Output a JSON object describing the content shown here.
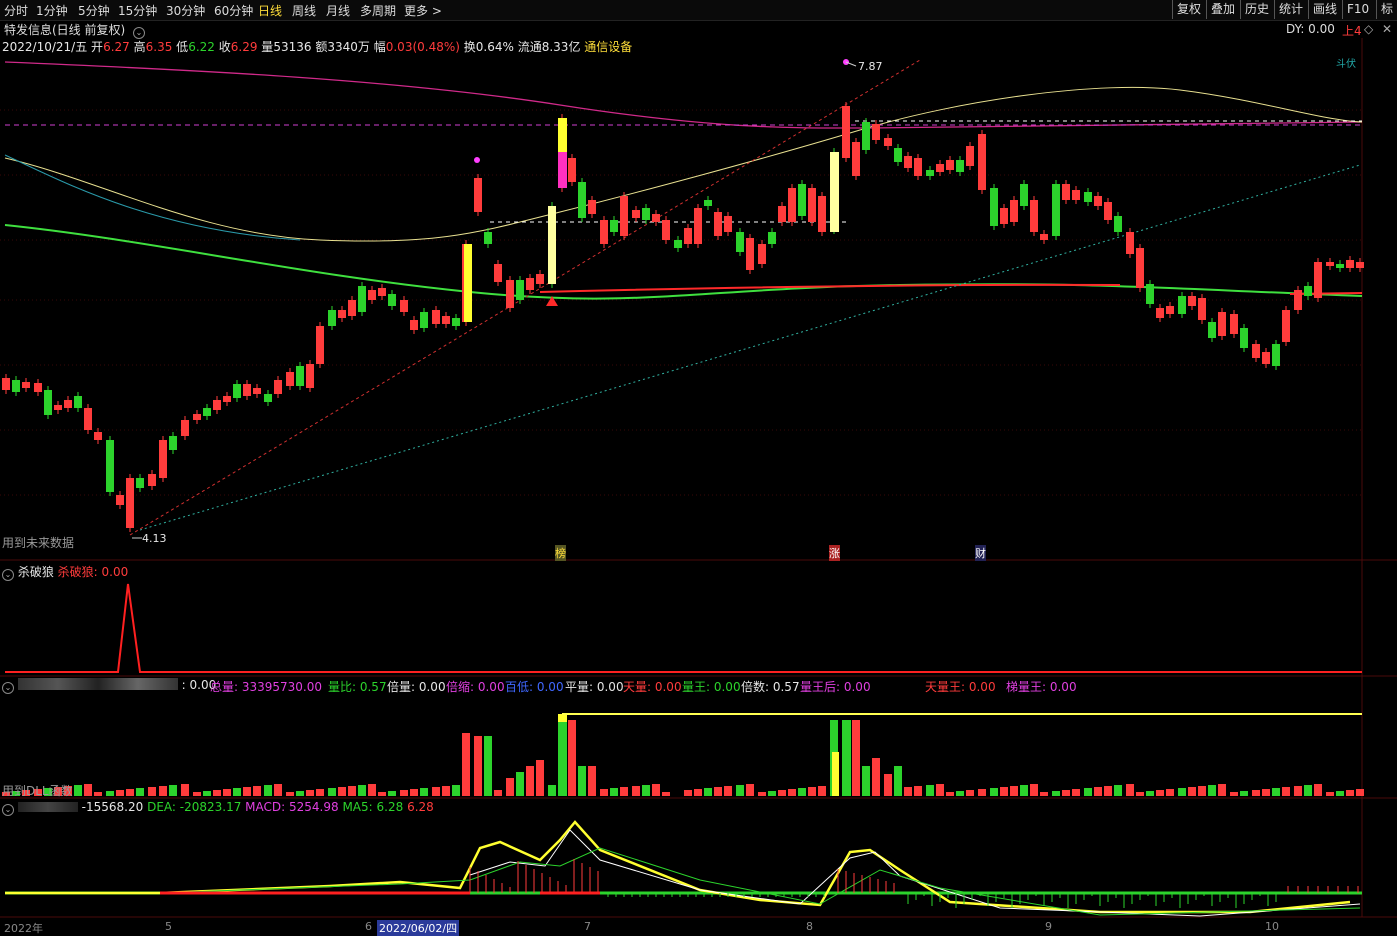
{
  "toolbar": {
    "periods": [
      "分时",
      "1分钟",
      "5分钟",
      "15分钟",
      "30分钟",
      "60分钟",
      "日线",
      "周线",
      "月线",
      "多周期",
      "更多 >"
    ],
    "active_period": "日线",
    "right_buttons": [
      "复权",
      "叠加",
      "历史",
      "统计",
      "画线",
      "F10",
      "标"
    ]
  },
  "title": {
    "stock": "特发信息(日线 前复权)",
    "dy": "DY: 0.00",
    "l4": "上4"
  },
  "info": {
    "date": "2022/10/21/五",
    "open_label": "开",
    "open": "6.27",
    "high_label": "高",
    "high": "6.35",
    "low_label": "低",
    "low": "6.22",
    "close_label": "收",
    "close": "6.29",
    "vol_label": "量",
    "vol": "53136",
    "amt_label": "额",
    "amt": "3340万",
    "chg_label": "幅",
    "chg": "0.03(0.48%)",
    "turn": "换0.64%",
    "float": "流通8.33亿",
    "sector": "通信设备"
  },
  "price_chart": {
    "high_marker": "7.87",
    "low_marker": "4.13",
    "future_note": "用到未来数据",
    "event_tags": [
      "榜",
      "涨",
      "财"
    ],
    "top_right_label": "斗伏"
  },
  "indicator1": {
    "name": "杀破狼",
    "value_label": "杀破狼: 0.00"
  },
  "indicator2": {
    "first": ": 0.00",
    "items": [
      {
        "label": "总量: 33395730.00",
        "color": "#e040e0"
      },
      {
        "label": "量比: 0.57",
        "color": "#2cd32c"
      },
      {
        "label": "倍量: 0.00",
        "color": "#e6e6e6"
      },
      {
        "label": "倍缩: 0.00",
        "color": "#e040e0"
      },
      {
        "label": "百低: 0.00",
        "color": "#4068ff"
      },
      {
        "label": "平量: 0.00",
        "color": "#e6e6e6"
      },
      {
        "label": "天量: 0.00",
        "color": "#ff3c3c"
      },
      {
        "label": "量王: 0.00",
        "color": "#2cd32c"
      },
      {
        "label": "倍数: 0.57",
        "color": "#e6e6e6"
      },
      {
        "label": "量王后: 0.00",
        "color": "#e040e0"
      },
      {
        "label": "天量王: 0.00",
        "color": "#ff3c3c"
      },
      {
        "label": "梯量王: 0.00",
        "color": "#e040e0"
      }
    ],
    "note": "用到DLL函数"
  },
  "macd": {
    "diff": "-15568.20",
    "dea": "DEA: -20823.17",
    "macd": "MACD: 5254.98",
    "ma5": "MA5: 6.28",
    "last": "6.28"
  },
  "xaxis": {
    "labels": [
      "2022年",
      "5",
      "6",
      "2022/06/02/四",
      "7",
      "8",
      "9",
      "10"
    ]
  },
  "colors": {
    "up": "#ff3c3c",
    "down": "#2cd32c",
    "background": "#000000",
    "accent": "#ffde3a"
  }
}
